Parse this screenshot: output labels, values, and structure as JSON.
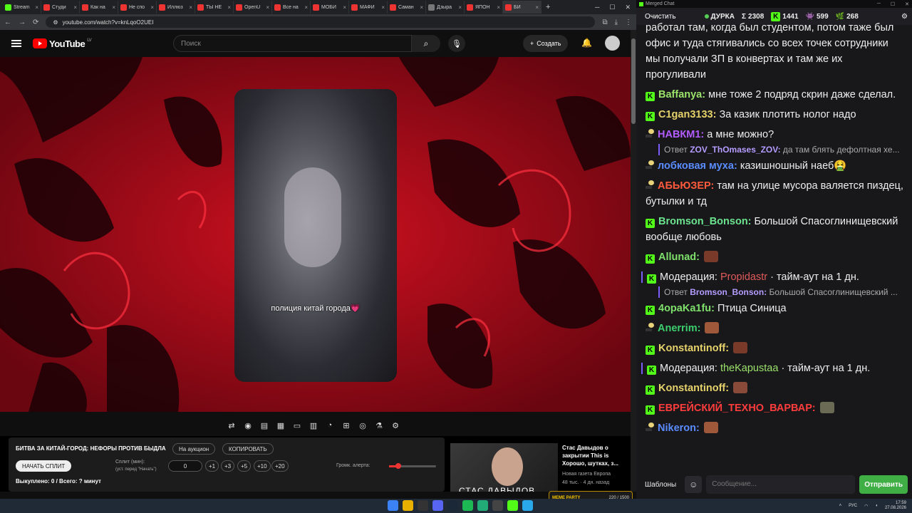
{
  "browser": {
    "tabs": [
      {
        "label": "Stream",
        "color": "#53fc18"
      },
      {
        "label": "Студи",
        "color": "#e33"
      },
      {
        "label": "Как на",
        "color": "#e33"
      },
      {
        "label": "Не спо",
        "color": "#e33"
      },
      {
        "label": "Иллюз",
        "color": "#e33"
      },
      {
        "label": "ТЫ НЕ",
        "color": "#e33"
      },
      {
        "label": "OpenU",
        "color": "#e33"
      },
      {
        "label": "Все на",
        "color": "#e33"
      },
      {
        "label": "МОБИ",
        "color": "#e33"
      },
      {
        "label": "МАФИ",
        "color": "#e33"
      },
      {
        "label": "Саман",
        "color": "#e33"
      },
      {
        "label": "Дзыра",
        "color": "#777"
      },
      {
        "label": "ЯПОН",
        "color": "#e33"
      },
      {
        "label": "БИ",
        "color": "#e33"
      }
    ],
    "new_tab": "+",
    "url": "youtube.com/watch?v=knLqoO2UEI"
  },
  "youtube": {
    "logo_text": "YouTube",
    "region": "LV",
    "search_placeholder": "Поиск",
    "create_label": "Создать"
  },
  "video": {
    "caption": "полиция китай города💗"
  },
  "panel": {
    "title": "БИТВА ЗА КИТАЙ-ГОРОД: НЕФОРЫ ПРОТИВ БЫДЛА",
    "auction_label": "На аукцион",
    "copy_label": "КОПИРОВАТЬ",
    "start_split_label": "НАЧАТЬ СПЛИТ",
    "split_label": "Сплит (мин):",
    "split_hint": "(уст. перед \"Начать\")",
    "split_value": "0",
    "increments": [
      "+1",
      "+3",
      "+5",
      "+10",
      "+20"
    ],
    "volume_label": "Громк. алерта:",
    "volume_level": 0.2,
    "bought": "Выкуплено: 0 / Всего: ? минут"
  },
  "recommendation": {
    "thumb_title": "СТАС ДАВЫДОВ",
    "title": "Стас Давыдов о закрытии This is Хорошо, шутках, з...",
    "channel": "Новая газета Европа",
    "meta": "48 тыс. · 4 дн. назад"
  },
  "alert": {
    "label": "MEME PARTY",
    "progress": "220 / 1500"
  },
  "chat": {
    "window_title": "Merged Chat",
    "clear_label": "Очистить",
    "channel": "ДУРКА",
    "stats": [
      {
        "icon": "Σ",
        "value": "2308"
      },
      {
        "icon": "K",
        "value": "1441"
      },
      {
        "icon": "👾",
        "value": "599"
      },
      {
        "icon": "🌿",
        "value": "268"
      }
    ],
    "messages": [
      {
        "type": "text",
        "platform": "none",
        "nick": "",
        "color": "#eee",
        "text": "работал там, когда был студентом, потом таже был офис и туда стягивались со всех точек сотрудники мы получали ЗП в конвертах и там же их прогуливали"
      },
      {
        "type": "text",
        "platform": "kick",
        "nick": "Baffanya:",
        "color": "#9be36b",
        "text": "мне тоже 2 подряд скрин даже сделал."
      },
      {
        "type": "text",
        "platform": "kick",
        "nick": "C1gan3133:",
        "color": "#e6d26b",
        "text": "За казик плотить нолог надо"
      },
      {
        "type": "text",
        "platform": "twitch",
        "nick": "НАВКМ1:",
        "color": "#b35cff",
        "text": "а мне можно?"
      },
      {
        "type": "reply",
        "prefix": "Ответ",
        "nick": "ZOV_ThOmases_ZOV:",
        "text": "да там блять дефолтная хе..."
      },
      {
        "type": "text",
        "platform": "twitch",
        "nick": "лобковая муха:",
        "color": "#5a8cff",
        "text": "казишношный наеб🤮"
      },
      {
        "type": "text",
        "platform": "twitch",
        "nick": "АБЬЮЗЕР:",
        "color": "#ff5a3c",
        "text": "там на улице мусора валяется пиздец, бутылки и тд"
      },
      {
        "type": "text",
        "platform": "kick",
        "nick": "Bromson_Bonson:",
        "color": "#6be38e",
        "text": "Большой Спасоглинищевский вообще любовь"
      },
      {
        "type": "text",
        "platform": "kick",
        "nick": "Allunad:",
        "color": "#7ee06b",
        "text": ""
      },
      {
        "type": "mod",
        "label": "Модерация:",
        "target": "Propidastr",
        "target_color": "#e05a5a",
        "text": "· тайм-аут на 1 дн."
      },
      {
        "type": "reply",
        "prefix": "Ответ",
        "nick": "Bromson_Bonson:",
        "text": "Большой Спасоглинищевский ..."
      },
      {
        "type": "text",
        "platform": "kick",
        "nick": "4opaKa1fu:",
        "color": "#7ee06b",
        "text": "Птица Синица"
      },
      {
        "type": "text",
        "platform": "twitch",
        "nick": "Anerrim:",
        "color": "#3ccf6e",
        "text": ""
      },
      {
        "type": "text",
        "platform": "kick",
        "nick": "Konstantinoff:",
        "color": "#e6d26b",
        "text": ""
      },
      {
        "type": "mod",
        "label": "Модерация:",
        "target": "theKapustaa",
        "target_color": "#9be36b",
        "text": "· тайм-аут на 1 дн."
      },
      {
        "type": "text",
        "platform": "kick",
        "nick": "Konstantinoff:",
        "color": "#e6d26b",
        "text": ""
      },
      {
        "type": "text",
        "platform": "kick",
        "nick": "ЕВРЕЙСКИЙ_ТЕХНО_ВАРВАР:",
        "color": "#ff3c3c",
        "text": ""
      },
      {
        "type": "text",
        "platform": "twitch",
        "nick": "Nikeron:",
        "color": "#5a8cff",
        "text": ""
      }
    ],
    "templates_label": "Шаблоны",
    "input_placeholder": "Сообщение...",
    "send_label": "Отправить"
  },
  "taskbar": {
    "lang": "РУС",
    "time": "17:59",
    "date": "27.08.2026"
  }
}
